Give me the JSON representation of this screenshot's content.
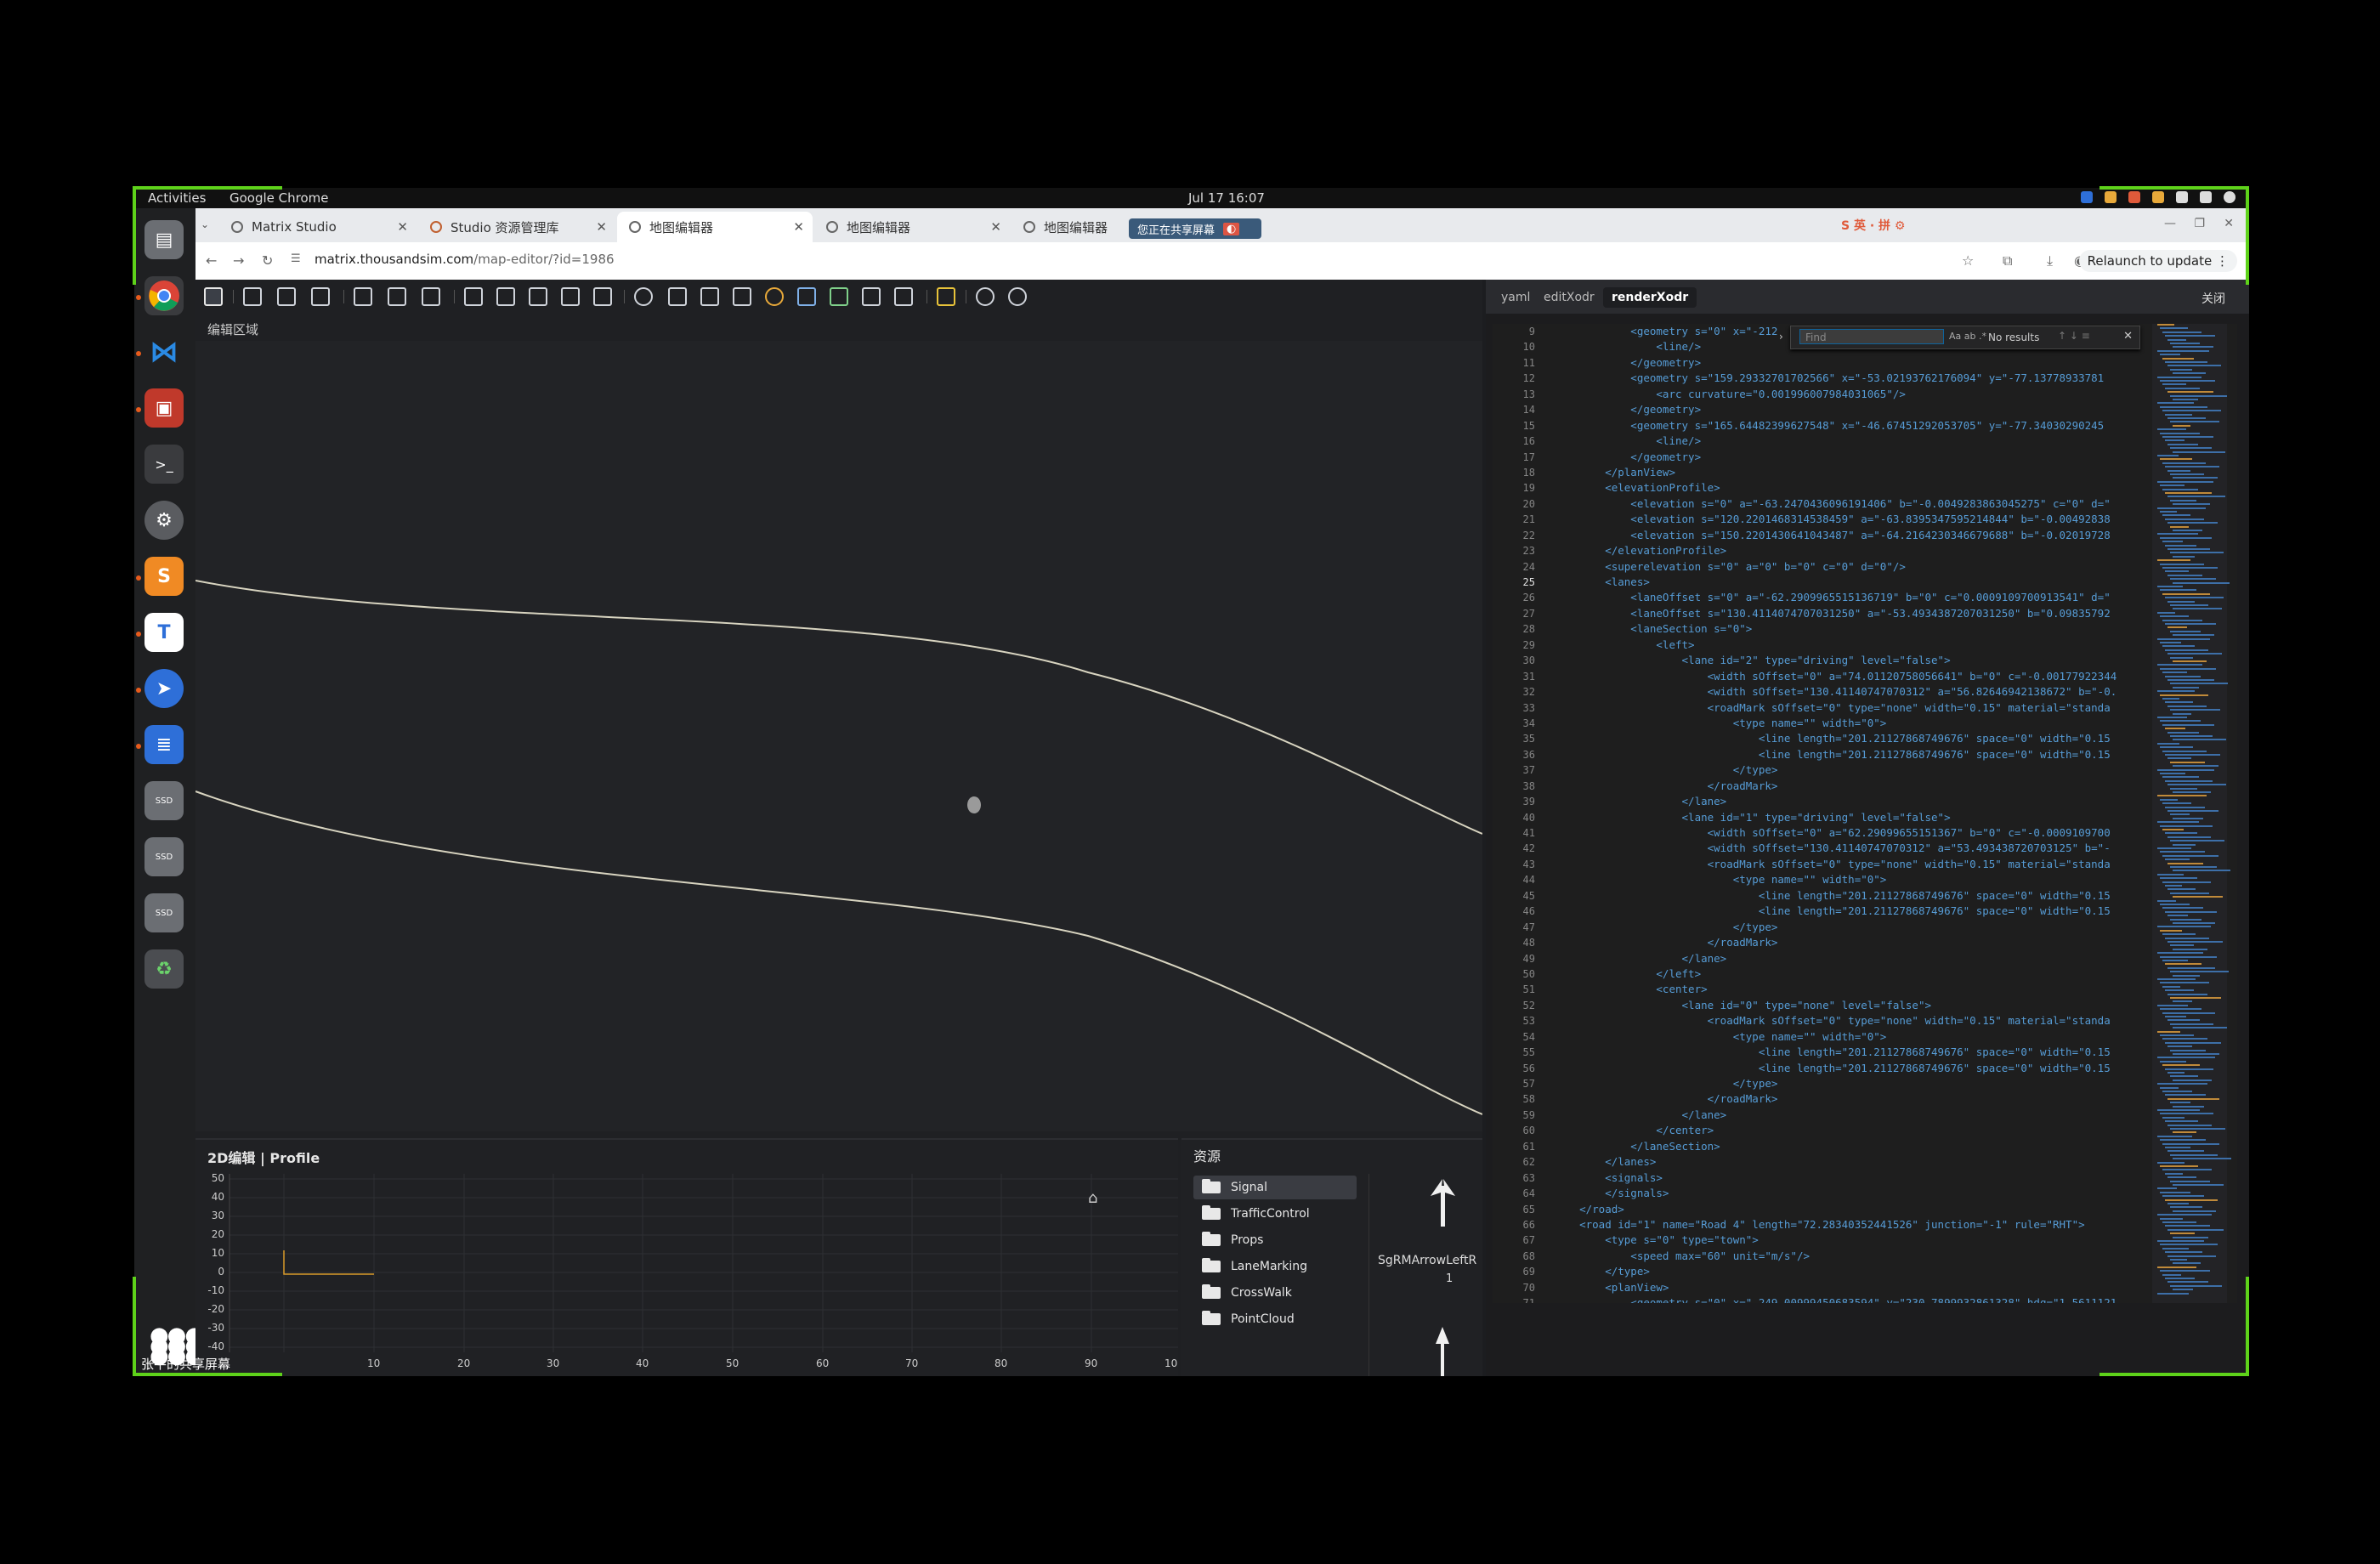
{
  "system": {
    "activities": "Activities",
    "app_name": "Google Chrome",
    "clock": "Jul 17  16:07",
    "screen_share_label": "张平的共享屏幕"
  },
  "browser": {
    "tabs": [
      {
        "label": "Matrix Studio",
        "active": false
      },
      {
        "label": "Studio 资源管理库",
        "active": false
      },
      {
        "label": "地图编辑器",
        "active": true
      },
      {
        "label": "地图编辑器",
        "active": false
      },
      {
        "label": "地图编辑器",
        "active": false
      }
    ],
    "sharing_badge": "您正在共享屏幕",
    "url_host": "matrix.thousandsim.com",
    "url_path": "/map-editor/?id=1986",
    "relaunch_label": "Relaunch to update"
  },
  "editor": {
    "area_label": "编辑区域",
    "profile_title": "2D编辑 | Profile",
    "profile_y_ticks": [
      "50",
      "40",
      "30",
      "20",
      "10",
      "0",
      "-10",
      "-20",
      "-30",
      "-40"
    ],
    "profile_x_ticks": [
      "10",
      "20",
      "30",
      "40",
      "50",
      "60",
      "70",
      "80",
      "90",
      "10"
    ],
    "assets_title": "资源",
    "asset_folders": [
      "Signal",
      "TrafficControl",
      "Props",
      "LaneMarking",
      "CrossWalk",
      "PointCloud"
    ],
    "asset_item_name": "SgRMArrowLeftR",
    "asset_item_count": "1"
  },
  "code_panel": {
    "tabs": [
      "yaml",
      "editXodr",
      "renderXodr"
    ],
    "active_tab": "renderXodr",
    "close_label": "关闭",
    "find_placeholder": "Find",
    "find_result": "No results",
    "line_numbers": [
      "9",
      "10",
      "11",
      "12",
      "13",
      "14",
      "15",
      "16",
      "17",
      "18",
      "19",
      "20",
      "21",
      "22",
      "23",
      "24",
      "25",
      "26",
      "27",
      "28",
      "29",
      "30",
      "31",
      "32",
      "33",
      "34",
      "35",
      "36",
      "37",
      "38",
      "39",
      "40",
      "41",
      "42",
      "43",
      "44",
      "45",
      "46",
      "47",
      "48",
      "49",
      "50",
      "51",
      "52",
      "53",
      "54",
      "55",
      "56",
      "57",
      "58",
      "59",
      "60",
      "61",
      "62",
      "63",
      "64",
      "65",
      "66",
      "67",
      "68",
      "69",
      "70",
      "71"
    ],
    "lines": [
      "            <geometry s=\"0\" x=\"-212",
      "                <line/>",
      "            </geometry>",
      "            <geometry s=\"159.29332701702566\" x=\"-53.02193762176094\" y=\"-77.13778933781",
      "                <arc curvature=\"0.001996007984031065\"/>",
      "            </geometry>",
      "            <geometry s=\"165.64482399627548\" x=\"-46.67451292053705\" y=\"-77.34030290245",
      "                <line/>",
      "            </geometry>",
      "        </planView>",
      "        <elevationProfile>",
      "            <elevation s=\"0\" a=\"-63.2470436096191406\" b=\"-0.0049283863045275\" c=\"0\" d=\"",
      "            <elevation s=\"120.2201468314538459\" a=\"-63.8395347595214844\" b=\"-0.00492838",
      "            <elevation s=\"150.2201430641043487\" a=\"-64.2164230346679688\" b=\"-0.02019728",
      "        </elevationProfile>",
      "        <superelevation s=\"0\" a=\"0\" b=\"0\" c=\"0\" d=\"0\"/>",
      "        <lanes>",
      "            <laneOffset s=\"0\" a=\"-62.2909965515136719\" b=\"0\" c=\"0.0009109700913541\" d=\"",
      "            <laneOffset s=\"130.4114074707031250\" a=\"-53.4934387207031250\" b=\"0.09835792",
      "            <laneSection s=\"0\">",
      "                <left>",
      "                    <lane id=\"2\" type=\"driving\" level=\"false\">",
      "                        <width sOffset=\"0\" a=\"74.01120758056641\" b=\"0\" c=\"-0.00177922344",
      "                        <width sOffset=\"130.41140747070312\" a=\"56.82646942138672\" b=\"-0.",
      "                        <roadMark sOffset=\"0\" type=\"none\" width=\"0.15\" material=\"standa",
      "                            <type name=\"\" width=\"0\">",
      "                                <line length=\"201.21127868749676\" space=\"0\" width=\"0.15",
      "                                <line length=\"201.21127868749676\" space=\"0\" width=\"0.15",
      "                            </type>",
      "                        </roadMark>",
      "                    </lane>",
      "                    <lane id=\"1\" type=\"driving\" level=\"false\">",
      "                        <width sOffset=\"0\" a=\"62.29099655151367\" b=\"0\" c=\"-0.0009109700",
      "                        <width sOffset=\"130.41140747070312\" a=\"53.493438720703125\" b=\"-",
      "                        <roadMark sOffset=\"0\" type=\"none\" width=\"0.15\" material=\"standa",
      "                            <type name=\"\" width=\"0\">",
      "                                <line length=\"201.21127868749676\" space=\"0\" width=\"0.15",
      "                                <line length=\"201.21127868749676\" space=\"0\" width=\"0.15",
      "                            </type>",
      "                        </roadMark>",
      "                    </lane>",
      "                </left>",
      "                <center>",
      "                    <lane id=\"0\" type=\"none\" level=\"false\">",
      "                        <roadMark sOffset=\"0\" type=\"none\" width=\"0.15\" material=\"standa",
      "                            <type name=\"\" width=\"0\">",
      "                                <line length=\"201.21127868749676\" space=\"0\" width=\"0.15",
      "                                <line length=\"201.21127868749676\" space=\"0\" width=\"0.15",
      "                            </type>",
      "                        </roadMark>",
      "                    </lane>",
      "                </center>",
      "            </laneSection>",
      "        </lanes>",
      "        <signals>",
      "        </signals>",
      "    </road>",
      "    <road id=\"1\" name=\"Road 4\" length=\"72.28340352441526\" junction=\"-1\" rule=\"RHT\">",
      "        <type s=\"0\" type=\"town\">",
      "            <speed max=\"60\" unit=\"m/s\"/>",
      "        </type>",
      "        <planView>",
      "            <geometry s=\"0\" x=\"-249.00999450683594\" y=\"230.7899932861328\" hdg=\"1.5611121"
    ],
    "current_line": "25"
  }
}
